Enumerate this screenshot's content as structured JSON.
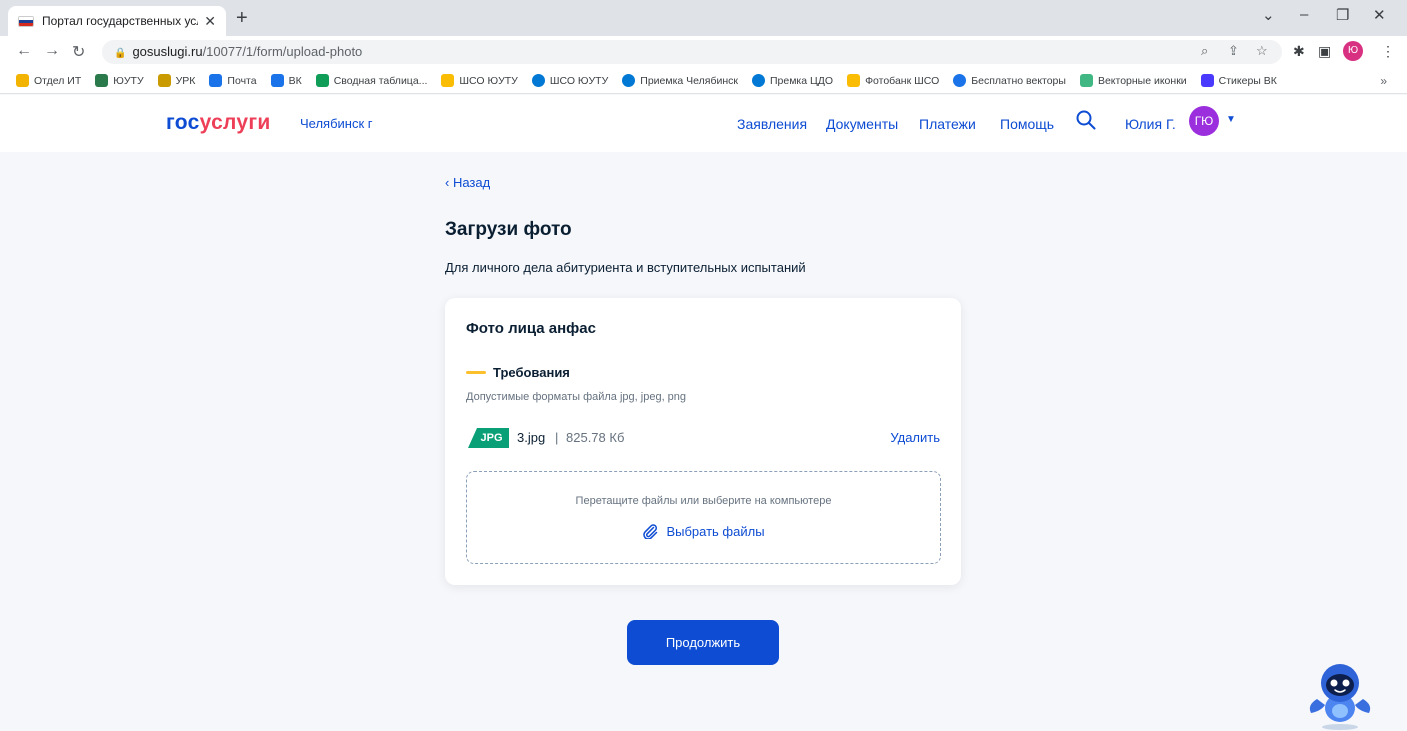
{
  "browser": {
    "tab_title": "Портал государственных услуг",
    "url_host": "gosuslugi.ru",
    "url_path": "/10077/1/form/upload-photo",
    "profile_initial": "Ю",
    "bookmarks": [
      {
        "label": "Отдел ИТ",
        "icon": "folder-icon",
        "color": "#f2b400"
      },
      {
        "label": "ЮУТУ",
        "icon": "graduation-icon",
        "color": "#2b7a4b"
      },
      {
        "label": "УРК",
        "icon": "leaf-icon",
        "color": "#c99b00"
      },
      {
        "label": "Почта",
        "icon": "mail-icon",
        "color": "#1a73e8"
      },
      {
        "label": "ВК",
        "icon": "vk-chat-icon",
        "color": "#1a73e8"
      },
      {
        "label": "Сводная таблица...",
        "icon": "sheets-icon",
        "color": "#0f9d58"
      },
      {
        "label": "ШСО ЮУТУ",
        "icon": "drive-icon",
        "color": "#fbbc04"
      },
      {
        "label": "ШСО ЮУТУ",
        "icon": "cloud-icon",
        "color": "#0078d4"
      },
      {
        "label": "Приемка Челябинск",
        "icon": "cloud-icon",
        "color": "#0078d4"
      },
      {
        "label": "Премка ЦДО",
        "icon": "cloud-icon",
        "color": "#0078d4"
      },
      {
        "label": "Фотобанк ШСО",
        "icon": "drive-icon",
        "color": "#fbbc04"
      },
      {
        "label": "Бесплатно векторы",
        "icon": "vector-icon",
        "color": "#1a73e8"
      },
      {
        "label": "Векторные иконки",
        "icon": "vue-icon",
        "color": "#41b883"
      },
      {
        "label": "Стикеры ВК",
        "icon": "vk-icon",
        "color": "#4a3aff"
      }
    ]
  },
  "header": {
    "logo_part1": "гос",
    "logo_part2": "услуги",
    "city": "Челябинск г",
    "nav": [
      "Заявления",
      "Документы",
      "Платежи",
      "Помощь"
    ],
    "user_name": "Юлия Г.",
    "user_initials": "ГЮ",
    "brand_color": "#0d4cd3",
    "accent_color": "#ee3f58",
    "avatar_color": "#9b2fde"
  },
  "content": {
    "back_label": "Назад",
    "title": "Загрузи фото",
    "subtitle": "Для личного дела абитуриента и вступительных испытаний"
  },
  "card": {
    "title": "Фото лица анфас",
    "requirements_title": "Требования",
    "requirements_text": "Допустимые форматы файла jpg, jpeg, png",
    "file": {
      "badge": "JPG",
      "name": "3.jpg",
      "separator": "|",
      "size": "825.78 Кб",
      "badge_color": "#099f77"
    },
    "delete_label": "Удалить",
    "dropzone_hint": "Перетащите файлы или выберите на компьютере",
    "choose_label": "Выбрать файлы"
  },
  "actions": {
    "continue_label": "Продолжить"
  }
}
